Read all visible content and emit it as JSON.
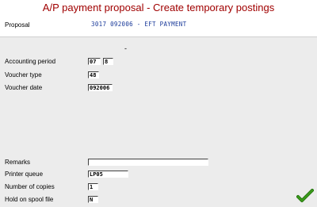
{
  "window": {
    "title": "A/P payment proposal - Create temporary postings"
  },
  "header": {
    "proposal_label": "Proposal",
    "proposal_value": "3017  092006  -  EFT PAYMENT"
  },
  "separator": "-",
  "form": {
    "accounting_period": {
      "label": "Accounting period",
      "year": "07",
      "period": "8"
    },
    "voucher_type": {
      "label": "Voucher type",
      "value": "48"
    },
    "voucher_date": {
      "label": "Voucher date",
      "value": "092006"
    },
    "remarks": {
      "label": "Remarks",
      "value": ""
    },
    "printer_queue": {
      "label": "Printer queue",
      "value": "LP05"
    },
    "number_of_copies": {
      "label": "Number of copies",
      "value": "1"
    },
    "hold_on_spool_file": {
      "label": "Hold on spool file",
      "value": "N"
    }
  },
  "actions": {
    "ok_icon": "green-checkmark-icon"
  },
  "colors": {
    "title": "#a00000",
    "proposal_value": "#1a3a9a",
    "check": "#3a9a1a"
  }
}
